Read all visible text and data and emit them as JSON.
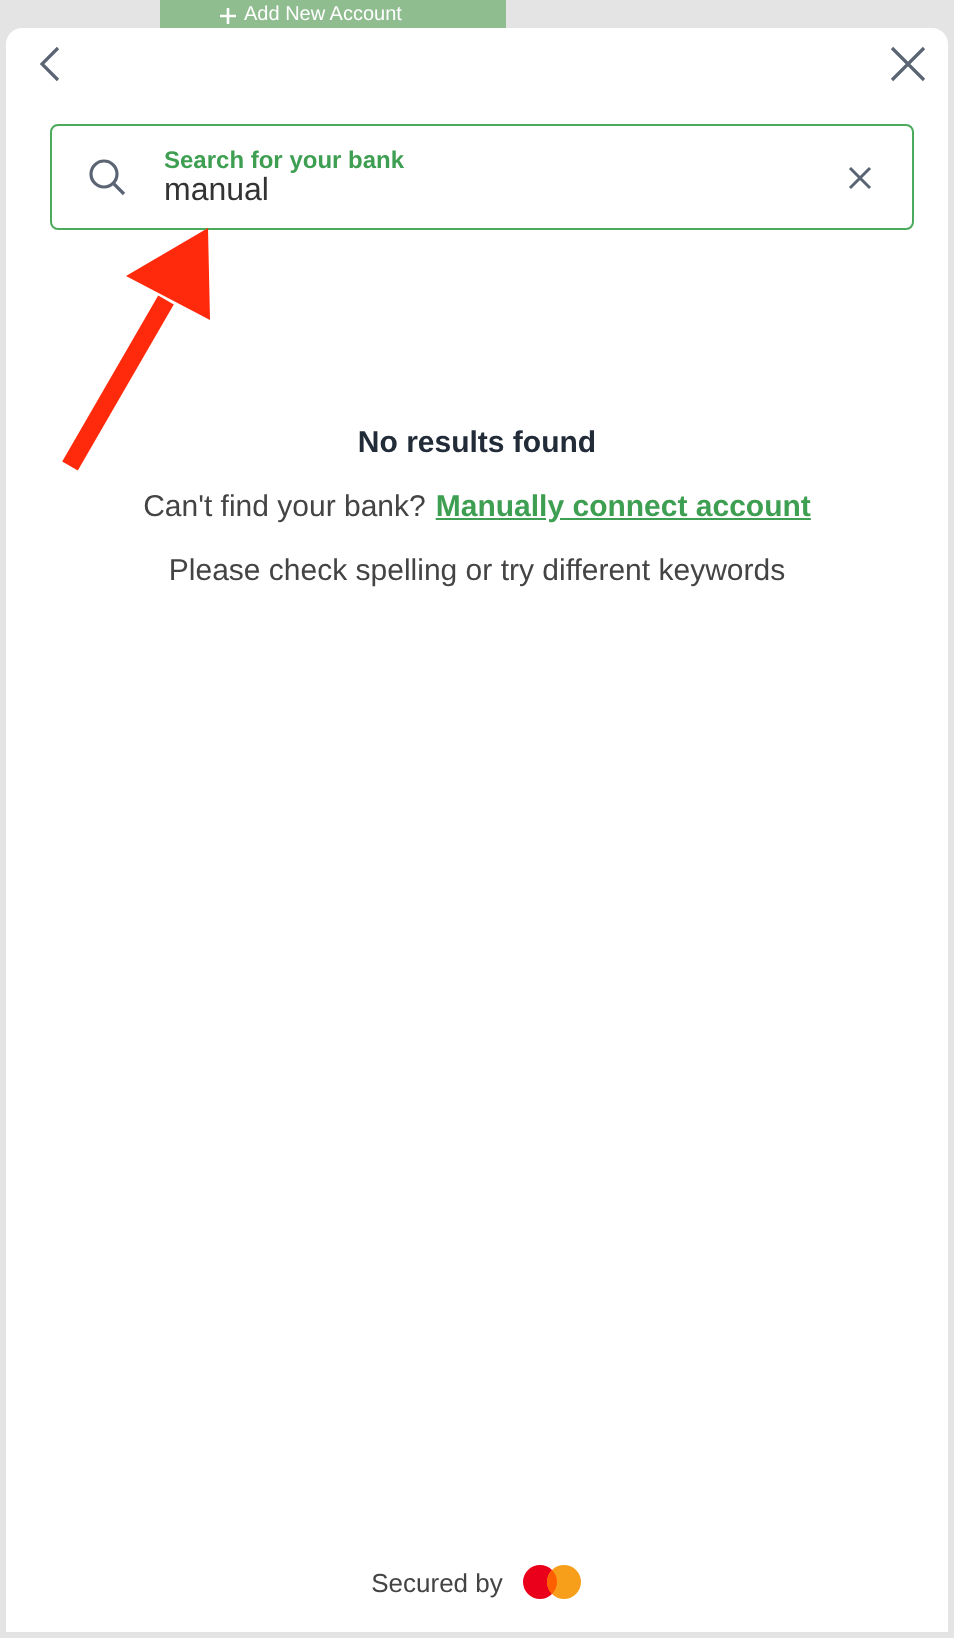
{
  "background_button": {
    "label": "Add New Account"
  },
  "search": {
    "label": "Search for your bank",
    "value": "manual"
  },
  "empty_state": {
    "title": "No results found",
    "prompt": "Can't find your bank?",
    "link": "Manually connect account",
    "hint": "Please check spelling or try different keywords"
  },
  "footer": {
    "label": "Secured by"
  }
}
